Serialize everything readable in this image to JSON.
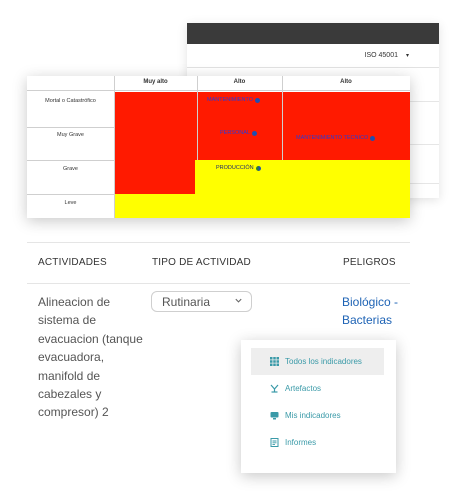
{
  "back_window": {
    "iso_select": "ISO 45001",
    "caret": "▾"
  },
  "matrix": {
    "columns": [
      "Muy alto",
      "Alto",
      "Alto"
    ],
    "rows": [
      "Mortal o Catastrófico",
      "Muy Grave",
      "Grave",
      "Leve"
    ],
    "tags": [
      {
        "label": "MANTENIMIENTO"
      },
      {
        "label": "PERSONAL"
      },
      {
        "label": "MANTENIMIENTO TECNICO"
      },
      {
        "label": "PRODUCCIÓN"
      }
    ],
    "colors": {
      "high": "#ff1a00",
      "medium": "#ffff00"
    }
  },
  "table": {
    "headers": {
      "actividades": "ACTIVIDADES",
      "tipo": "TIPO DE ACTIVIDAD",
      "peligros": "PELIGROS"
    },
    "row": {
      "actividad": "Alineacion de sistema de evacuacion (tanque evacuadora, manifold de cabezales y compresor) 2",
      "tipo_actividad": "Rutinaria",
      "peligro": "Biológico - Bacterias"
    }
  },
  "nav": {
    "items": [
      {
        "label": "Todos los indicadores",
        "icon": "grid-icon",
        "active": true
      },
      {
        "label": "Artefactos",
        "icon": "artifact-icon",
        "active": false
      },
      {
        "label": "Mis indicadores",
        "icon": "monitor-icon",
        "active": false
      },
      {
        "label": "Informes",
        "icon": "report-icon",
        "active": false
      }
    ],
    "color": "#3a9aa8"
  }
}
